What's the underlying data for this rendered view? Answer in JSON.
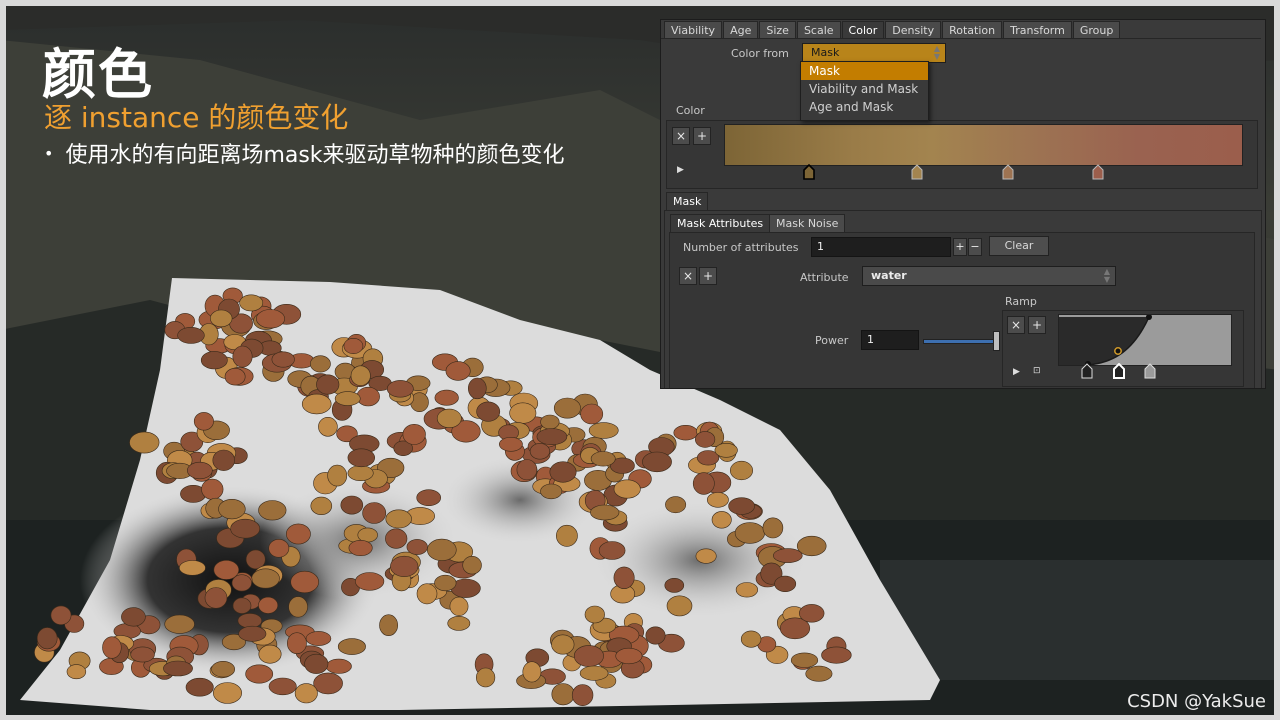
{
  "slide": {
    "title": "颜色",
    "subtitle": "逐 instance 的颜色变化",
    "bullet": "使用水的有向距离场mask来驱动草物种的颜色变化"
  },
  "panel": {
    "tabs": [
      "Viability",
      "Age",
      "Size",
      "Scale",
      "Color",
      "Density",
      "Rotation",
      "Transform",
      "Group"
    ],
    "active_tab": "Color",
    "color_from_label": "Color from",
    "color_from_value": "Mask",
    "color_from_options": [
      "Mask",
      "Viability and Mask",
      "Age and Mask"
    ],
    "color_label": "Color",
    "mask_tab": "Mask",
    "mask_subtabs": [
      "Mask Attributes",
      "Mask Noise"
    ],
    "number_of_attributes_label": "Number of attributes",
    "number_of_attributes_value": "1",
    "clear_label": "Clear",
    "attribute_label": "Attribute",
    "attribute_value": "water",
    "ramp_label": "Ramp",
    "power_label": "Power",
    "power_value": "1",
    "plus": "+",
    "minus": "−",
    "close": "×"
  },
  "colors": {
    "accent_orange": "#f0a030",
    "menu_highlight": "#c37d00",
    "dropdown_bg": "#b8841a",
    "gradient_start": "#7d6536",
    "gradient_end": "#9b5e4c"
  },
  "watermark": "CSDN @YakSue"
}
